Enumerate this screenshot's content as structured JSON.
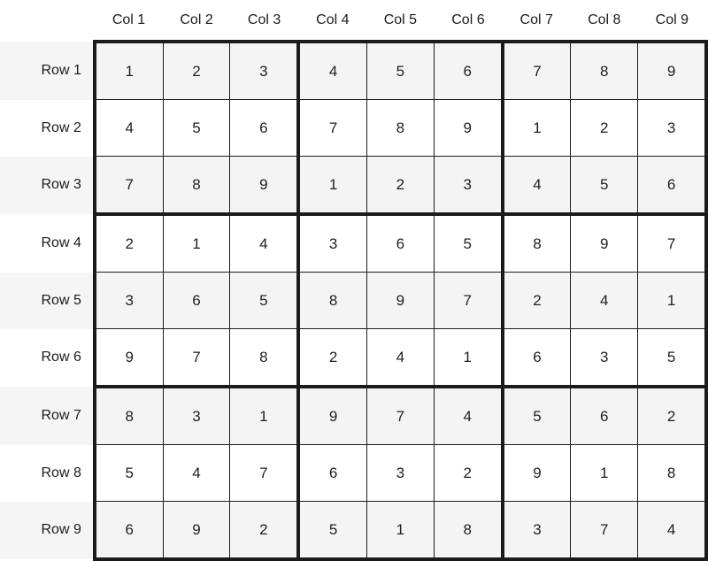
{
  "grid": {
    "corner_label": "",
    "column_headers": [
      "Col 1",
      "Col 2",
      "Col 3",
      "Col 4",
      "Col 5",
      "Col 6",
      "Col 7",
      "Col 8",
      "Col 9"
    ],
    "row_headers": [
      "Row 1",
      "Row 2",
      "Row 3",
      "Row 4",
      "Row 5",
      "Row 6",
      "Row 7",
      "Row 8",
      "Row 9"
    ],
    "rows": [
      [
        "1",
        "2",
        "3",
        "4",
        "5",
        "6",
        "7",
        "8",
        "9"
      ],
      [
        "4",
        "5",
        "6",
        "7",
        "8",
        "9",
        "1",
        "2",
        "3"
      ],
      [
        "7",
        "8",
        "9",
        "1",
        "2",
        "3",
        "4",
        "5",
        "6"
      ],
      [
        "2",
        "1",
        "4",
        "3",
        "6",
        "5",
        "8",
        "9",
        "7"
      ],
      [
        "3",
        "6",
        "5",
        "8",
        "9",
        "7",
        "2",
        "4",
        "1"
      ],
      [
        "9",
        "7",
        "8",
        "2",
        "4",
        "1",
        "6",
        "3",
        "5"
      ],
      [
        "8",
        "3",
        "1",
        "9",
        "7",
        "4",
        "5",
        "6",
        "2"
      ],
      [
        "5",
        "4",
        "7",
        "6",
        "3",
        "2",
        "9",
        "1",
        "8"
      ],
      [
        "6",
        "9",
        "2",
        "5",
        "1",
        "8",
        "3",
        "7",
        "4"
      ]
    ],
    "block_size": 3,
    "colors": {
      "page_background": "#ffffff",
      "stripe_background": "#f4f4f4",
      "cell_background": "#ffffff",
      "grid_line": "#1b1b1b",
      "block_line": "#000000",
      "digit_text": "#1f1f1f",
      "header_text": "#1b1b1b"
    }
  }
}
